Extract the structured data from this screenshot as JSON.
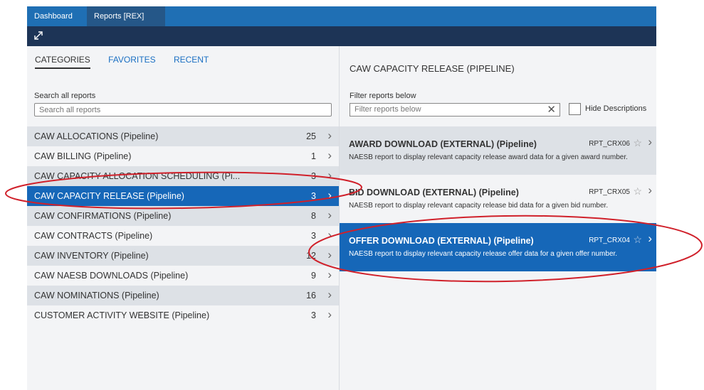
{
  "tabs": [
    {
      "label": "Dashboard"
    },
    {
      "label": "Reports [REX]",
      "close": "✕"
    }
  ],
  "left": {
    "category_tabs": [
      "CATEGORIES",
      "FAVORITES",
      "RECENT"
    ],
    "search_label": "Search all reports",
    "search_placeholder": "Search all reports",
    "categories": [
      {
        "name": "CAW ALLOCATIONS (Pipeline)",
        "count": "25"
      },
      {
        "name": "CAW BILLING (Pipeline)",
        "count": "1"
      },
      {
        "name": "CAW CAPACITY ALLOCATION SCHEDULING (Pi...",
        "count": "3"
      },
      {
        "name": "CAW CAPACITY RELEASE (Pipeline)",
        "count": "3"
      },
      {
        "name": "CAW CONFIRMATIONS (Pipeline)",
        "count": "8"
      },
      {
        "name": "CAW CONTRACTS (Pipeline)",
        "count": "3"
      },
      {
        "name": "CAW INVENTORY (Pipeline)",
        "count": "12"
      },
      {
        "name": "CAW NAESB DOWNLOADS (Pipeline)",
        "count": "9"
      },
      {
        "name": "CAW NOMINATIONS (Pipeline)",
        "count": "16"
      },
      {
        "name": "CUSTOMER ACTIVITY WEBSITE (Pipeline)",
        "count": "3"
      }
    ]
  },
  "right": {
    "title": "CAW CAPACITY RELEASE (PIPELINE)",
    "filter_label": "Filter reports below",
    "filter_placeholder": "Filter reports below",
    "hide_descriptions_label": "Hide Descriptions",
    "reports": [
      {
        "name": "AWARD DOWNLOAD (EXTERNAL) (Pipeline)",
        "code": "RPT_CRX06",
        "description": "NAESB report to display relevant capacity release award data for a given award number."
      },
      {
        "name": "BID DOWNLOAD (EXTERNAL) (Pipeline)",
        "code": "RPT_CRX05",
        "description": "NAESB report to display relevant capacity release bid data for a given bid number."
      },
      {
        "name": "OFFER DOWNLOAD (EXTERNAL) (Pipeline)",
        "code": "RPT_CRX04",
        "description": "NAESB report to display relevant capacity release offer data for a given offer number."
      }
    ]
  },
  "colors": {
    "tab_bar": "#1f6fb4",
    "toolbar": "#1d3456",
    "selected": "#1667b8",
    "annotation": "#d0202a"
  },
  "icons": {
    "expand": "expand-icon",
    "close": "close-icon",
    "chevron": "chevron-right-icon",
    "star": "star-icon"
  }
}
